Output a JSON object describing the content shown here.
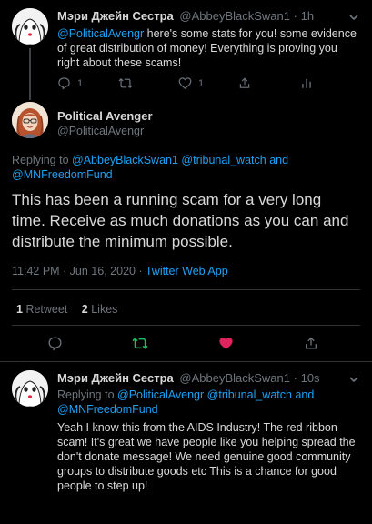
{
  "tweet1": {
    "display_name": "Мэри Джейн Сестра",
    "handle": "@AbbeyBlackSwan1",
    "separator": "·",
    "time": "1h",
    "mention": "@PoliticalAvengr",
    "text_line1": " here's some stats for you! some evidence",
    "text_line2": "of great distribution of money! Everything is proving you",
    "text_line3": "right about these scams!",
    "reply_count": "1",
    "like_count": "1"
  },
  "main": {
    "display_name": "Political Avenger",
    "handle": "@PoliticalAvengr",
    "replying_to_label": "Replying to ",
    "replying_to_users": [
      "@AbbeyBlackSwan1",
      "@tribunal_watch",
      "and"
    ],
    "replying_to_line2": "@MNFreedomFund",
    "text_line1": "This has been a running scam for a very long",
    "text_line2": "time. Receive as much donations as you can and",
    "text_line3": "distribute the minimum possible.",
    "timestamp": "11:42 PM · Jun 16, 2020 · ",
    "source": "Twitter Web App",
    "retweet_count": "1",
    "retweet_label": "Retweet",
    "like_count": "2",
    "like_label": "Likes"
  },
  "reply": {
    "display_name": "Мэри Джейн Сестра",
    "handle": "@AbbeyBlackSwan1",
    "separator": "·",
    "time": "10s",
    "replying_to_label": "Replying to ",
    "replying_to_users": [
      "@PoliticalAvengr",
      "@tribunal_watch",
      "and"
    ],
    "replying_to_line2": "@MNFreedomFund",
    "text_lines": [
      "Yeah I know this from the AIDS Industry! The red ribbon",
      "scam! It's great we have people like you helping spread the",
      "don't donate message! We need genuine good community",
      "groups to distribute goods etc This is a chance for good",
      "people to step up!"
    ]
  },
  "colors": {
    "link": "#1da1f2",
    "like_active": "#e0245e",
    "retweet_active": "#17bf63",
    "muted": "#6e767d",
    "background": "#000000"
  },
  "icons": [
    "reply-icon",
    "retweet-icon",
    "like-icon",
    "share-icon",
    "analytics-icon",
    "chevron-down-icon"
  ]
}
